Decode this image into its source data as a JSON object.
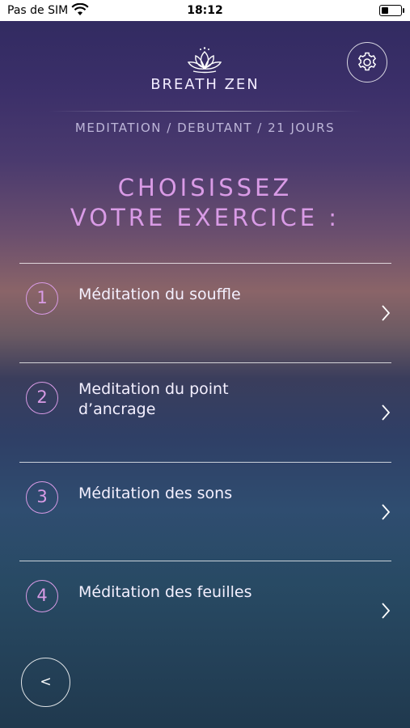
{
  "status_bar": {
    "carrier": "Pas de SIM",
    "time": "18:12",
    "battery_level": 0.35
  },
  "header": {
    "app_name": "BREATH ZEN",
    "breadcrumb": "MEDITATION / DEBUTANT / 21 JOURS"
  },
  "title": {
    "line1": "CHOISISSEZ",
    "line2": "VOTRE EXERCICE :"
  },
  "exercises": [
    {
      "number": "1",
      "label": "Méditation du souffle"
    },
    {
      "number": "2",
      "label": "Meditation du point d’ancrage"
    },
    {
      "number": "3",
      "label": "Méditation des sons"
    },
    {
      "number": "4",
      "label": "Méditation des feuilles"
    }
  ],
  "back_button": {
    "label": "<"
  },
  "colors": {
    "accent": "#d99be6",
    "text": "#f4f0ff"
  },
  "icons": {
    "settings": "gear-icon",
    "logo": "lotus-icon",
    "row_arrow": "chevron-right-icon"
  }
}
